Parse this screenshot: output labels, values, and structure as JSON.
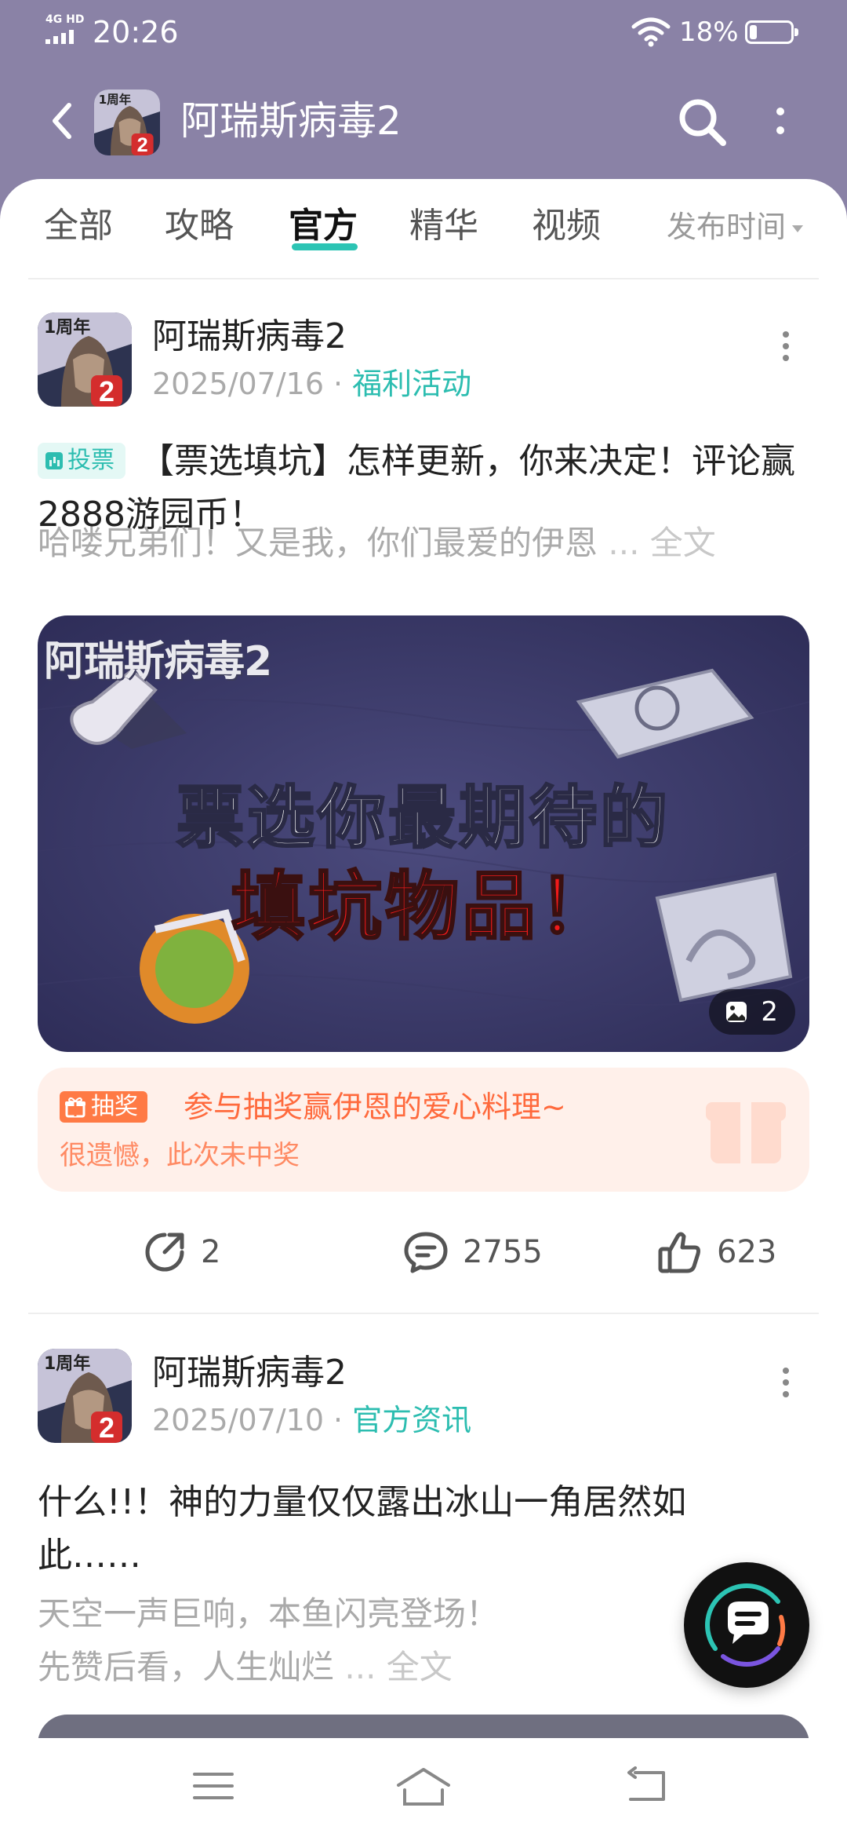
{
  "status_bar": {
    "network": "4G HD",
    "time": "20:26",
    "battery": "18%",
    "battery_level": 0.18
  },
  "header": {
    "title": "阿瑞斯病毒2",
    "icon_badge": "2",
    "icon_ribbon": "1周年"
  },
  "tabs": [
    {
      "label": "全部",
      "active": false
    },
    {
      "label": "攻略",
      "active": false
    },
    {
      "label": "官方",
      "active": true
    },
    {
      "label": "精华",
      "active": false
    },
    {
      "label": "视频",
      "active": false
    }
  ],
  "sort_label": "发布时间",
  "posts": [
    {
      "author": "阿瑞斯病毒2",
      "date": "2025/07/16",
      "separator": "·",
      "category": "福利活动",
      "tag": "投票",
      "title": "【票选填坑】怎样更新，你来决定！评论赢2888游园币！",
      "snippet": "哈喽兄弟们！又是我，你们最爱的伊恩",
      "snippet_more": "... 全文",
      "image": {
        "game_logo": "阿瑞斯病毒2",
        "headline_1": "票选你最期待的",
        "headline_2": "填坑物品！",
        "image_count": "2"
      },
      "lottery": {
        "tag": "抽奖",
        "title": "参与抽奖赢伊恩的爱心料理~",
        "status": "很遗憾，此次未中奖"
      },
      "shares": "2",
      "comments": "2755",
      "likes": "623"
    },
    {
      "author": "阿瑞斯病毒2",
      "date": "2025/07/10",
      "separator": "·",
      "category": "官方资讯",
      "title": "什么!!！神的力量仅仅露出冰山一角居然如此……",
      "snippet_line1": "天空一声巨响，本鱼闪亮登场！",
      "snippet_line2": "先赞后看，人生灿烂",
      "snippet_more": "... 全文"
    }
  ],
  "colors": {
    "accent": "#2cc4b4",
    "header_bg": "#8a82a6",
    "lottery_orange": "#ff6a3d"
  }
}
